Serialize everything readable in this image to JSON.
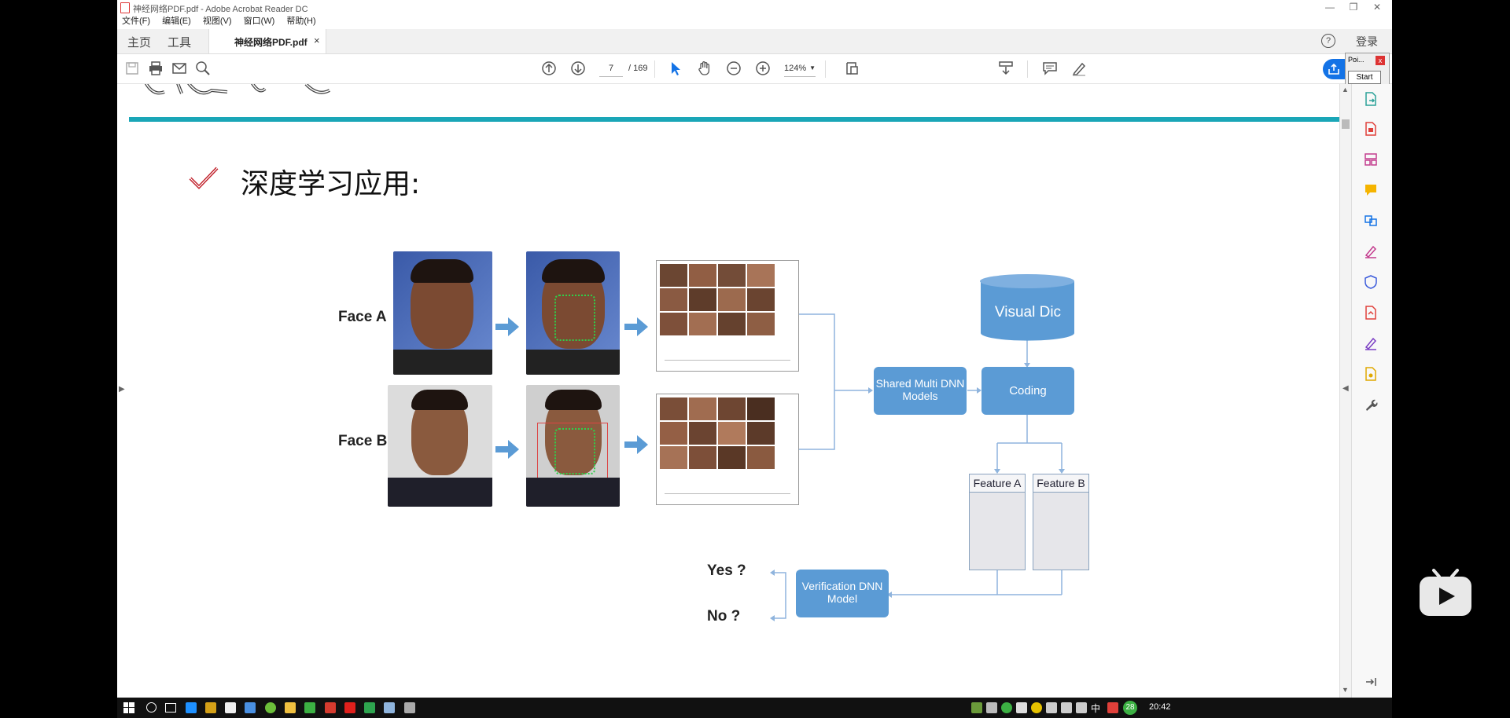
{
  "window": {
    "title": "神经网络PDF.pdf - Adobe Acrobat Reader DC"
  },
  "menu": [
    "文件(F)",
    "编辑(E)",
    "视图(V)",
    "窗口(W)",
    "帮助(H)"
  ],
  "tabs": {
    "home": "主页",
    "tools": "工具",
    "document": "神经网络PDF.pdf",
    "close": "×",
    "login": "登录"
  },
  "toolbar": {
    "page_current": "7",
    "page_total": "/ 169",
    "zoom": "124%"
  },
  "popup": {
    "title": "Poi...",
    "close": "x",
    "start": "Start"
  },
  "slide": {
    "heading": "深度学习应用:",
    "face_a_label": "Face A",
    "face_b_label": "Face B",
    "visual_dic": "Visual Dic",
    "shared_models": "Shared Multi DNN Models",
    "coding": "Coding",
    "feature_a": "Feature A",
    "feature_b": "Feature B",
    "verification": "Verification DNN Model",
    "yes": "Yes ?",
    "no": "No ?"
  },
  "taskbar": {
    "badge": "28",
    "ime": "中",
    "time": "20:42"
  },
  "colors": {
    "accent_teal": "#1aa6b7",
    "diagram_blue": "#5b9bd5",
    "acrobat_blue": "#1473e6",
    "check_red": "#c0202a"
  }
}
